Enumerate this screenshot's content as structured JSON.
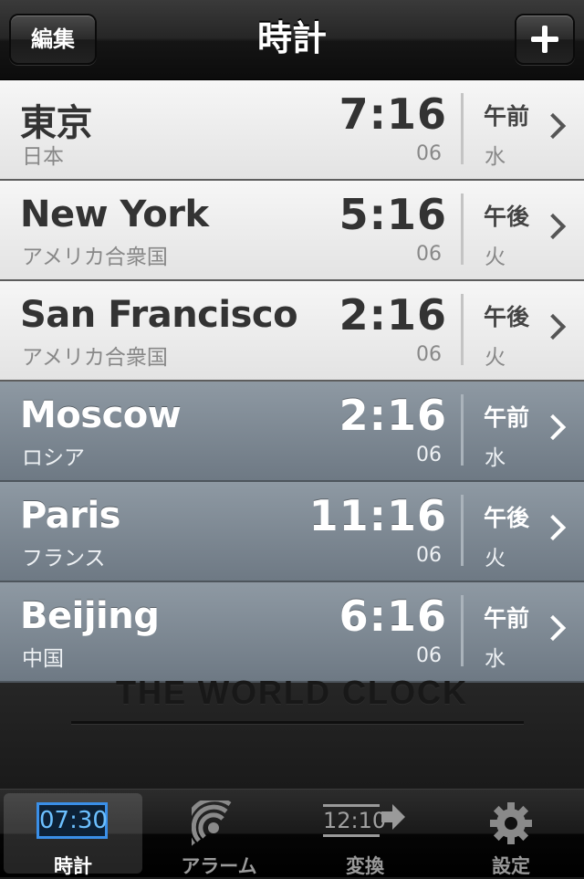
{
  "nav": {
    "title": "時計",
    "edit_label": "編集",
    "add_icon": "plus-icon"
  },
  "cities": [
    {
      "city": "東京",
      "country": "日本",
      "time": "7:16",
      "seconds": "06",
      "ampm": "午前",
      "weekday": "水",
      "theme": "day"
    },
    {
      "city": "New York",
      "country": "アメリカ合衆国",
      "time": "5:16",
      "seconds": "06",
      "ampm": "午後",
      "weekday": "火",
      "theme": "day"
    },
    {
      "city": "San Francisco",
      "country": "アメリカ合衆国",
      "time": "2:16",
      "seconds": "06",
      "ampm": "午後",
      "weekday": "火",
      "theme": "day"
    },
    {
      "city": "Moscow",
      "country": "ロシア",
      "time": "2:16",
      "seconds": "06",
      "ampm": "午前",
      "weekday": "水",
      "theme": "night"
    },
    {
      "city": "Paris",
      "country": "フランス",
      "time": "11:16",
      "seconds": "06",
      "ampm": "午後",
      "weekday": "火",
      "theme": "night"
    },
    {
      "city": "Beijing",
      "country": "中国",
      "time": "6:16",
      "seconds": "06",
      "ampm": "午前",
      "weekday": "水",
      "theme": "night"
    }
  ],
  "footer": {
    "brand": "THE WORLD CLOCK"
  },
  "tabs": [
    {
      "label": "時計",
      "icon": "digital-clock-icon",
      "icon_text": "07:30",
      "active": true
    },
    {
      "label": "アラーム",
      "icon": "alarm-signal-icon",
      "active": false
    },
    {
      "label": "変換",
      "icon": "convert-icon",
      "icon_text": "12:10",
      "active": false
    },
    {
      "label": "設定",
      "icon": "gear-icon",
      "active": false
    }
  ],
  "colors": {
    "accent": "#3a8fe8",
    "day_row": "#eeeeee",
    "night_row": "#7d8893"
  }
}
